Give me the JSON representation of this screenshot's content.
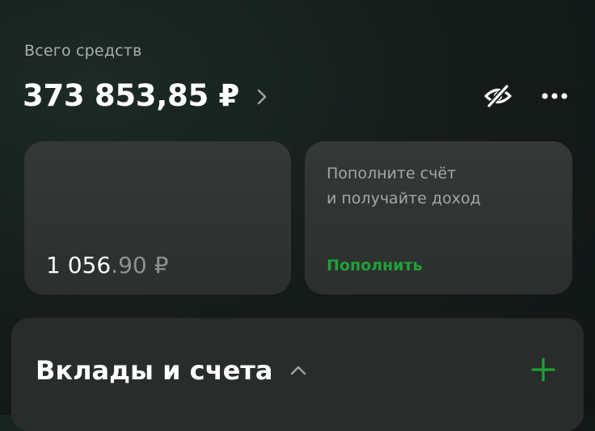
{
  "header": {
    "total_label": "Всего средств",
    "total_amount": "373 853,85 ₽",
    "icons": {
      "chevron": "chevron-right-icon",
      "hide": "eye-slash-icon",
      "more": "more-dots-icon"
    }
  },
  "cards": [
    {
      "balance_main": "1 056",
      "balance_fraction": ".90 ₽"
    },
    {
      "promo_line1": "Пополните счёт",
      "promo_line2": "и получайте доход",
      "action_label": "Пополнить"
    }
  ],
  "section": {
    "title": "Вклады и счета",
    "icons": {
      "collapse": "chevron-up-icon",
      "add": "plus-icon"
    }
  },
  "colors": {
    "accent": "#21a038",
    "background": "#141b19",
    "card": "#2f3331",
    "muted_text": "#a9b0ad"
  }
}
